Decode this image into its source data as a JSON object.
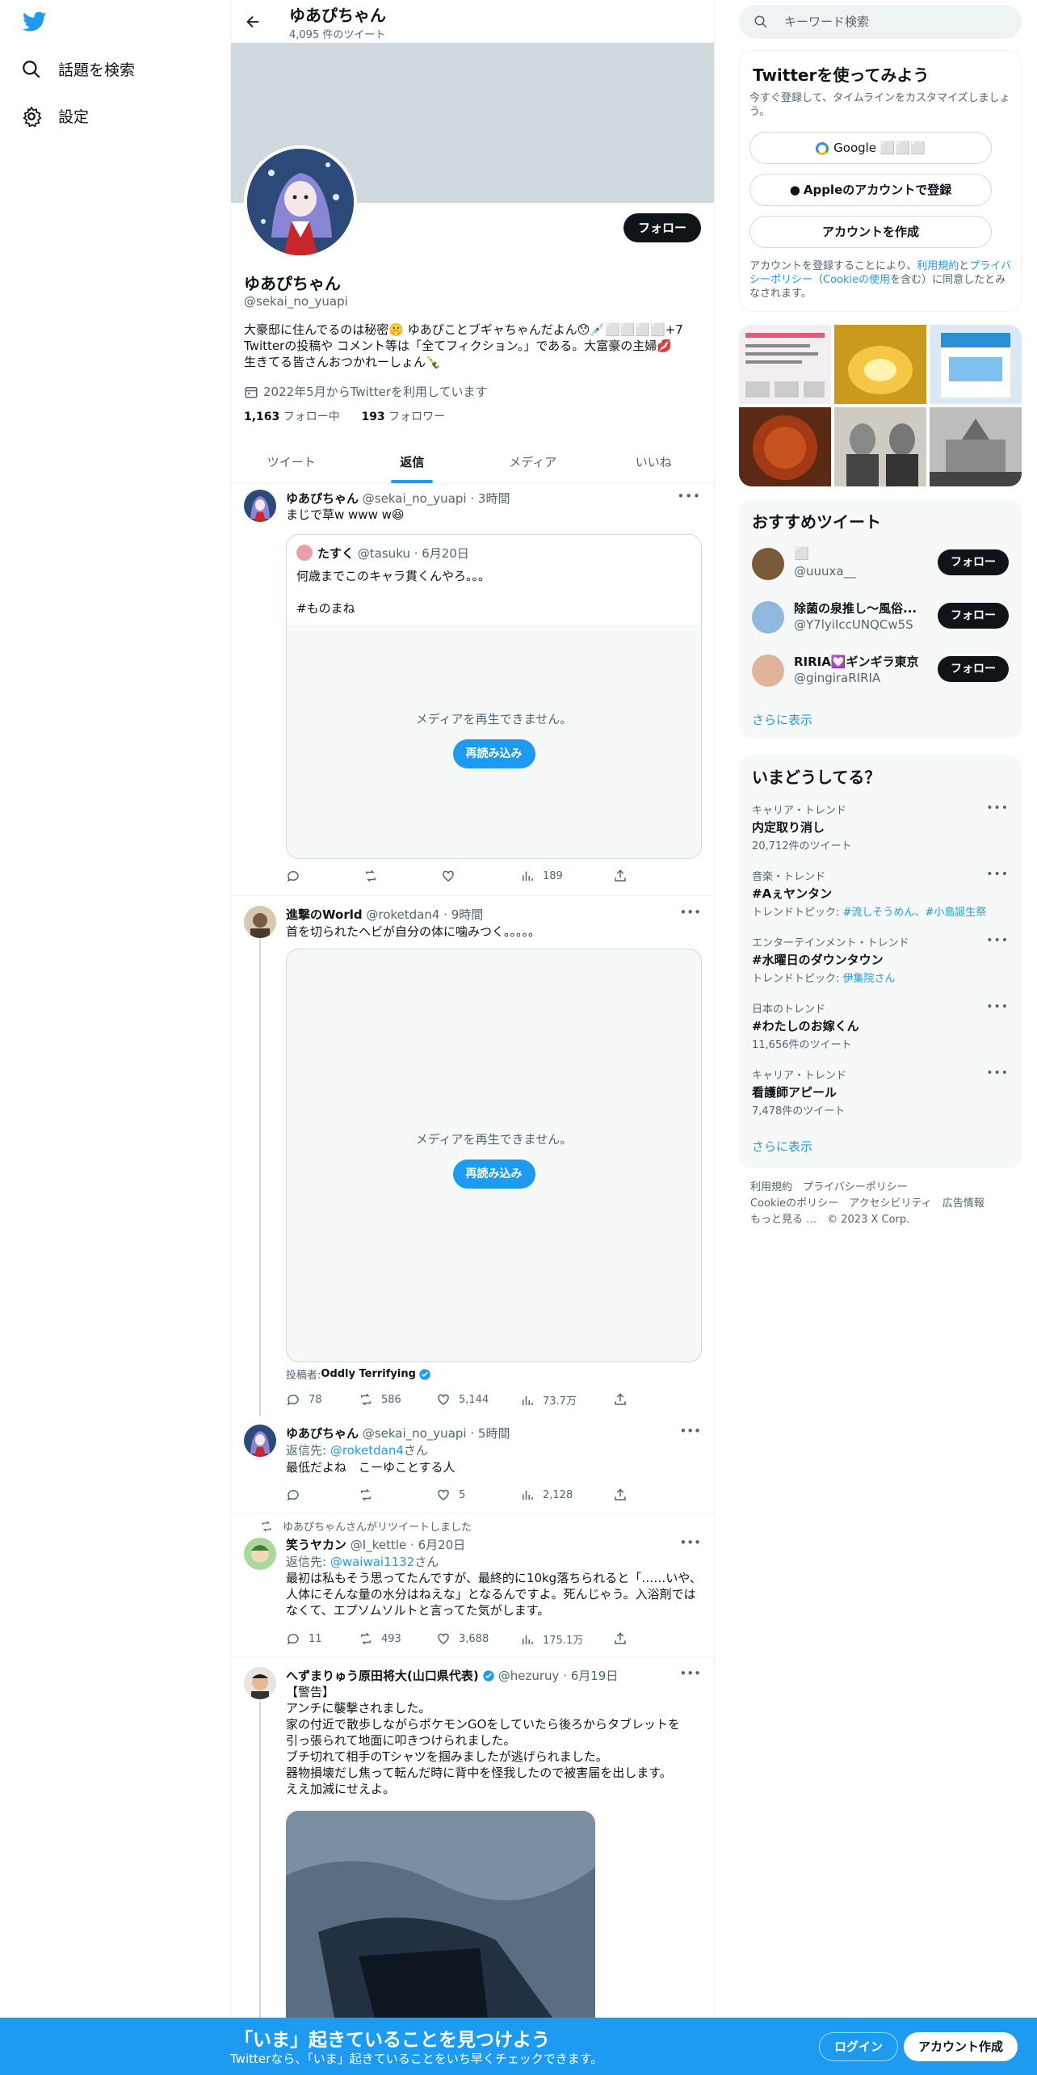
{
  "nav": {
    "explore": "話題を検索",
    "settings": "設定"
  },
  "header": {
    "name": "ゆあぴちゃん",
    "tweet_count": "4,095 件のツイート"
  },
  "profile": {
    "follow": "フォロー",
    "name": "ゆあぴちゃん",
    "handle": "@sekai_no_yuapi",
    "bio_line1": "大豪邸に住んでるのは秘密🤫 ゆあぴことブギャちゃんだよん😯💉⬜⬜⬜⬜+7",
    "bio_line2": "Twitterの投稿や コメント等は「全てフィクション。」である。大富豪の主婦💋",
    "bio_line3": "生きてる皆さんおつかれーしょん🍾",
    "joined": "2022年5月からTwitterを利用しています",
    "following_count": "1,163",
    "following_label": "フォロー中",
    "followers_count": "193",
    "followers_label": "フォロワー"
  },
  "tabs": [
    "ツイート",
    "返信",
    "メディア",
    "いいね"
  ],
  "tweets": {
    "t1": {
      "name": "ゆあぴちゃん",
      "handle": "@sekai_no_yuapi",
      "time": "3時間",
      "text": "まじで草w www w😆",
      "quote": {
        "name": "たすく",
        "handle": "@tasuku",
        "time": "6月20日",
        "text1": "何歳までこのキャラ貫くんやろ。。。",
        "text2": "#ものまね"
      },
      "media_msg": "メディアを再生できません。",
      "reload": "再読み込み",
      "views": "189"
    },
    "t2": {
      "name": "進撃のWorld",
      "handle": "@roketdan4",
      "time": "9時間",
      "text": "首を切られたヘビが自分の体に噛みつく。。。。。",
      "media_msg": "メディアを再生できません。",
      "reload": "再読み込み",
      "poster_label": "投稿者: ",
      "poster": "Oddly Terrifying",
      "replies": "78",
      "retweets": "586",
      "likes": "5,144",
      "views": "73.7万"
    },
    "t3": {
      "name": "ゆあぴちゃん",
      "handle": "@sekai_no_yuapi",
      "time": "5時間",
      "reply_label": "返信先: ",
      "reply_to": "@roketdan4",
      "reply_suffix": "さん",
      "text": "最低だよね　こーゆことする人",
      "likes": "5",
      "views": "2,128"
    },
    "t4": {
      "retweeted": "ゆあぴちゃんさんがリツイートしました",
      "name": "笑うヤカン",
      "handle": "@I_kettle",
      "time": "6月20日",
      "reply_label": "返信先: ",
      "reply_to": "@waiwai1132",
      "reply_suffix": "さん",
      "text1": "最初は私もそう思ってたんですが、最終的に10kg落ちられると「……いや、",
      "text2": "人体にそんな量の水分はねえな」となるんですよ。死んじゃう。入浴剤では",
      "text3": "なくて、エプソムソルトと言ってた気がします。",
      "replies": "11",
      "retweets": "493",
      "likes": "3,688",
      "views": "175.1万"
    },
    "t5": {
      "name": "へずまりゅう原田将大(山口県代表)",
      "handle": "@hezuruy",
      "time": "6月19日",
      "l1": "【警告】",
      "l2": "アンチに襲撃されました。",
      "l3": "家の付近で散歩しながらポケモンGOをしていたら後ろからタブレットを",
      "l4": "引っ張られて地面に叩きつけられました。",
      "l5": "ブチ切れて相手のTシャツを掴みましたが逃げられました。",
      "l6": "器物損壊だし焦って転んだ時に背中を怪我したので被害届を出します。",
      "l7": "ええ加減にせえよ。"
    }
  },
  "right": {
    "search_placeholder": "キーワード検索",
    "signup": {
      "title": "Twitterを使ってみよう",
      "sub1": "今すぐ登録して、タイムラインをカスタマイズしましょ",
      "sub2": "う。",
      "google": "Google ⬜⬜⬜",
      "apple": "Appleのアカウントで登録",
      "create": "アカウントを作成",
      "terms1a": "アカウントを登録することにより、",
      "terms1b": "利用規約",
      "terms1c": "と",
      "terms1d": "プライバ",
      "terms2a": "シーポリシー",
      "terms2b": "（",
      "terms2c": "Cookieの使用",
      "terms2d": "を含む）に同意したとみ",
      "terms3": "なされます。"
    },
    "recommended": {
      "title": "おすすめツイート",
      "users": [
        {
          "name": "⬜",
          "handle": "@uuuxa__",
          "follow": "フォロー"
        },
        {
          "name": "除菌の泉推し～風俗...",
          "handle": "@Y7lyiIccUNQCw5S",
          "follow": "フォロー"
        },
        {
          "name": "RIRIA💟ギンギラ東京",
          "handle": "@gingiraRIRIA",
          "follow": "フォロー"
        }
      ],
      "more": "さらに表示"
    },
    "trends": {
      "title": "いまどうしてる？",
      "items": [
        {
          "cat": "キャリア・トレンド",
          "name": "内定取り消し",
          "meta": "20,712件のツイート"
        },
        {
          "cat": "音楽・トレンド",
          "name": "#Aぇヤンタン",
          "meta_label": "トレンドトピック: ",
          "meta_link": "#流しそうめん、#小島誕生祭"
        },
        {
          "cat": "エンターテインメント・トレンド",
          "name": "#水曜日のダウンタウン",
          "meta_label": "トレンドトピック: ",
          "meta_link": "伊集院さん"
        },
        {
          "cat": "日本のトレンド",
          "name": "#わたしのお嫁くん",
          "meta": "11,656件のツイート"
        },
        {
          "cat": "キャリア・トレンド",
          "name": "看護師アピール",
          "meta": "7,478件のツイート"
        }
      ],
      "more": "さらに表示"
    },
    "footer": {
      "line1": "利用規約　プライバシーポリシー",
      "line2": "Cookieのポリシー　アクセシビリティ　広告情報",
      "line3": "もっと見る …　© 2023 X Corp."
    }
  },
  "bottom": {
    "title": "「いま」起きていることを見つけよう",
    "sub": "Twitterなら、「いま」起きていることをいち早くチェックできます。",
    "login": "ログイン",
    "signup": "アカウント作成"
  },
  "colors": {
    "accent": "#1d9bf0",
    "text": "#0f1419",
    "muted": "#536471",
    "banner": "#cfd9de"
  }
}
